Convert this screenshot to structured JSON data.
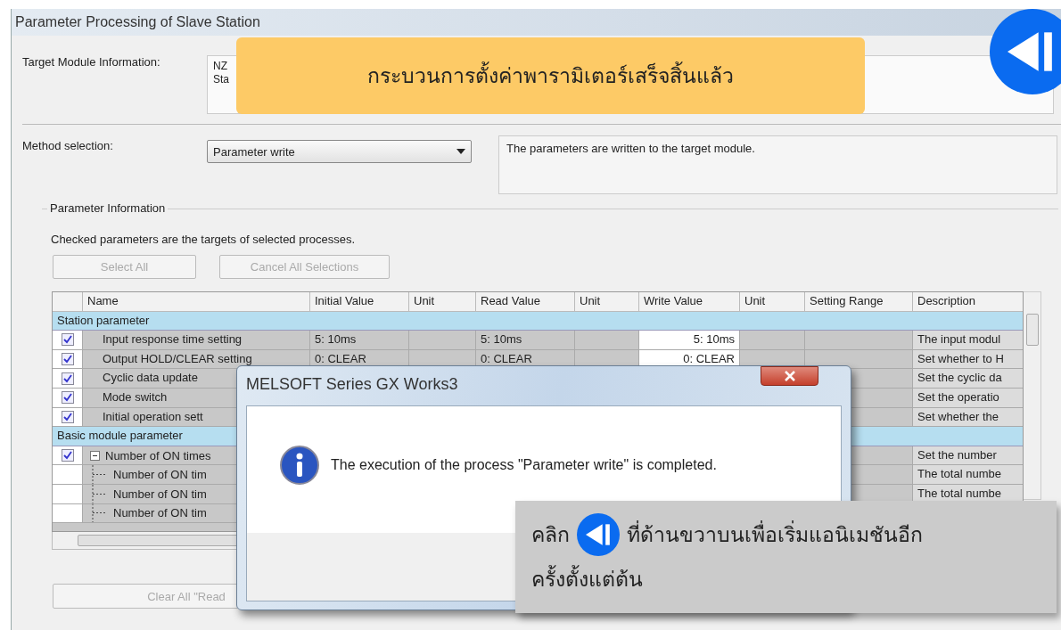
{
  "window": {
    "title": "Parameter Processing of Slave Station"
  },
  "target_module": {
    "label": "Target Module Information:",
    "lines": [
      "NZ",
      "Sta"
    ]
  },
  "method": {
    "label": "Method selection:",
    "value": "Parameter write",
    "description": "The parameters are written to the target module."
  },
  "parameter_info": {
    "legend": "Parameter Information",
    "note": "Checked parameters are the targets of selected processes.",
    "buttons": [
      {
        "label": "Select All",
        "disabled": true
      },
      {
        "label": "Cancel All Selections",
        "disabled": true
      }
    ]
  },
  "table": {
    "columns": [
      "Name",
      "Initial Value",
      "Unit",
      "Read Value",
      "Unit",
      "Write Value",
      "Unit",
      "Setting Range",
      "Description"
    ],
    "groups": [
      {
        "title": "Station parameter",
        "rows": [
          {
            "checked": true,
            "name": "Input response time setting",
            "initial": "5: 10ms",
            "read": "5: 10ms",
            "write": "5: 10ms",
            "description": "The input modul"
          },
          {
            "checked": true,
            "name": "Output HOLD/CLEAR setting",
            "initial": "0: CLEAR",
            "read": "0: CLEAR",
            "write": "0: CLEAR",
            "description": "Set whether to H"
          },
          {
            "checked": true,
            "name": "Cyclic data update",
            "description": "Set the cyclic da"
          },
          {
            "checked": true,
            "name": "Mode switch",
            "description": "Set the operatio"
          },
          {
            "checked": true,
            "name": "Initial operation sett",
            "description": "Set whether the"
          }
        ]
      },
      {
        "title": "Basic module parameter",
        "rows": [
          {
            "checked": true,
            "name": "Number of ON times",
            "description": "Set the number",
            "expanded": true,
            "children": [
              {
                "name": "Number of ON tim",
                "description": "The total numbe"
              },
              {
                "name": "Number of ON tim",
                "description": "The total numbe"
              },
              {
                "name": "Number of ON tim"
              }
            ]
          }
        ]
      }
    ]
  },
  "clear_button": {
    "label": "Clear All \"Read",
    "disabled": true
  },
  "dialog": {
    "title": "MELSOFT Series GX Works3",
    "message": "The execution of the process \"Parameter write\" is completed."
  },
  "banner": "กระบวนการตั้งค่าพารามิเตอร์เสร็จสิ้นแล้ว",
  "hint": {
    "before": "คลิก",
    "after": "ที่ด้านขวาบนเพื่อเริ่มแอนิเมชันอีก",
    "second_line": "ครั้งตั้งแต่ต้น"
  }
}
